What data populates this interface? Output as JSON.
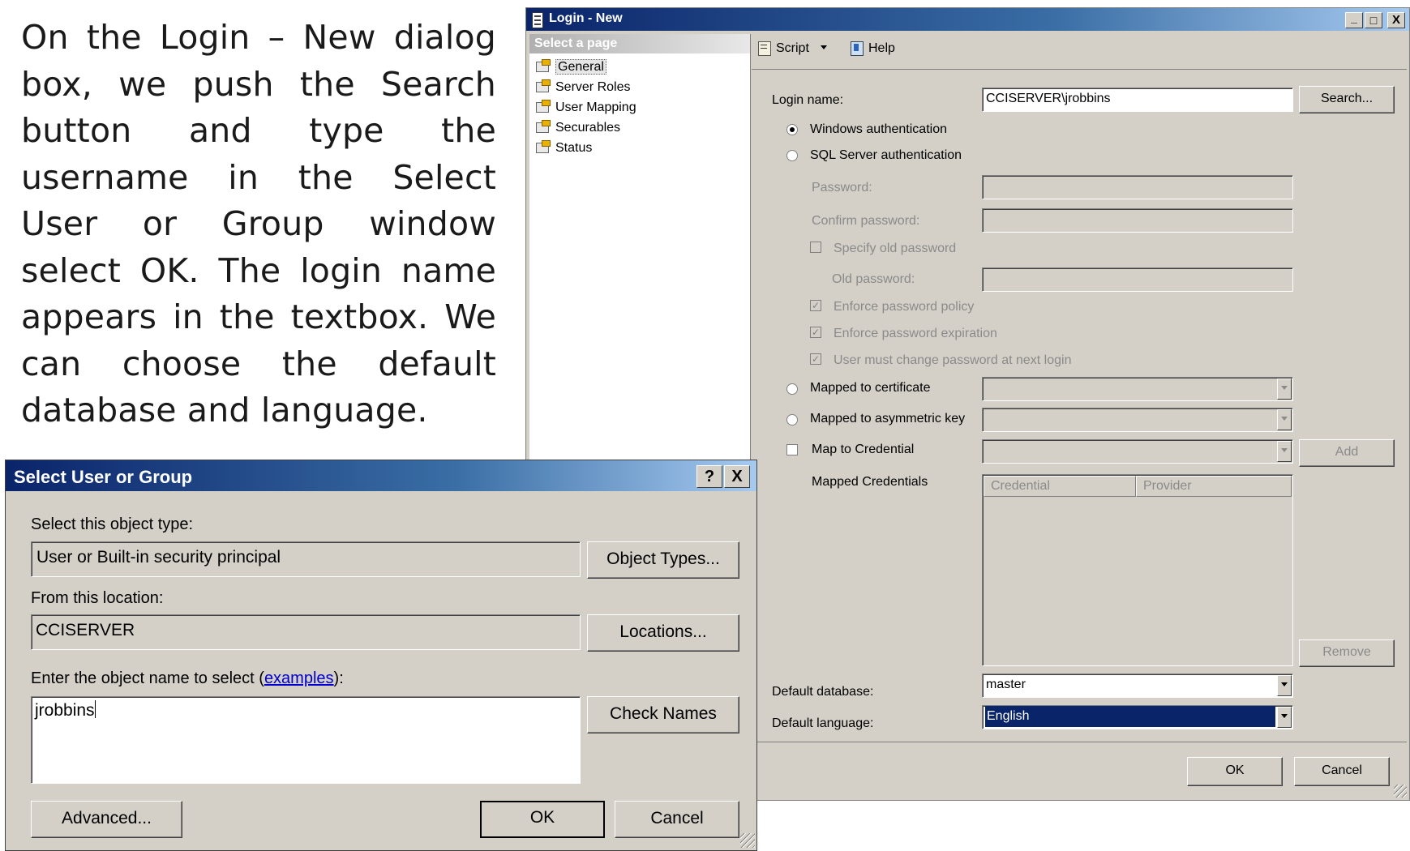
{
  "slide": {
    "paragraph": "On the Login – New dialog box, we push the Search button and type the username in the Select User or Group window select OK. The login name appears in the textbox. We can choose the default database and language."
  },
  "login_dialog": {
    "title": "Login - New",
    "title_icon": "server-login-icon",
    "caption_buttons": [
      "_",
      "□",
      "X"
    ],
    "select_page_header": "Select a page",
    "pages": [
      "General",
      "Server Roles",
      "User Mapping",
      "Securables",
      "Status"
    ],
    "selected_page": "General",
    "toolbar": {
      "script_label": "Script",
      "script_icon": "script-icon",
      "help_label": "Help",
      "help_icon": "help-icon"
    },
    "login_name_label": "Login name:",
    "login_name_value": "CCISERVER\\jrobbins",
    "search_button": "Search...",
    "windows_auth_label": "Windows authentication",
    "windows_auth_selected": true,
    "sql_auth_label": "SQL Server authentication",
    "password_label": "Password:",
    "confirm_password_label": "Confirm password:",
    "specify_old_password_label": "Specify old password",
    "old_password_label": "Old password:",
    "enforce_policy_label": "Enforce password policy",
    "enforce_expiration_label": "Enforce password expiration",
    "must_change_label": "User must change password at next login",
    "mapped_certificate_label": "Mapped to certificate",
    "mapped_asymmetric_label": "Mapped to asymmetric key",
    "map_credential_label": "Map to Credential",
    "add_button": "Add",
    "mapped_credentials_label": "Mapped Credentials",
    "credential_columns": [
      "Credential",
      "Provider"
    ],
    "remove_button": "Remove",
    "default_database_label": "Default database:",
    "default_database_value": "master",
    "default_language_label": "Default language:",
    "default_language_value": "English",
    "ok_button": "OK",
    "cancel_button": "Cancel"
  },
  "select_user_dialog": {
    "title": "Select User or Group",
    "caption_buttons": [
      "?",
      "X"
    ],
    "object_type_label": "Select this object type:",
    "object_type_value": "User or Built-in security principal",
    "object_types_button": "Object Types...",
    "location_label": "From this location:",
    "location_value": "CCISERVER",
    "locations_button": "Locations...",
    "object_name_label_prefix": "Enter the object name to select (",
    "examples_link": "examples",
    "object_name_label_suffix": "):",
    "object_name_value": "jrobbins",
    "check_names_button": "Check Names",
    "advanced_button": "Advanced...",
    "ok_button": "OK",
    "cancel_button": "Cancel"
  },
  "colors": {
    "titlebar_start": "#0a246a",
    "titlebar_end": "#a6caf0",
    "dialog_face": "#d4d0c8",
    "selection": "#0a246a",
    "link": "#0000cc"
  }
}
